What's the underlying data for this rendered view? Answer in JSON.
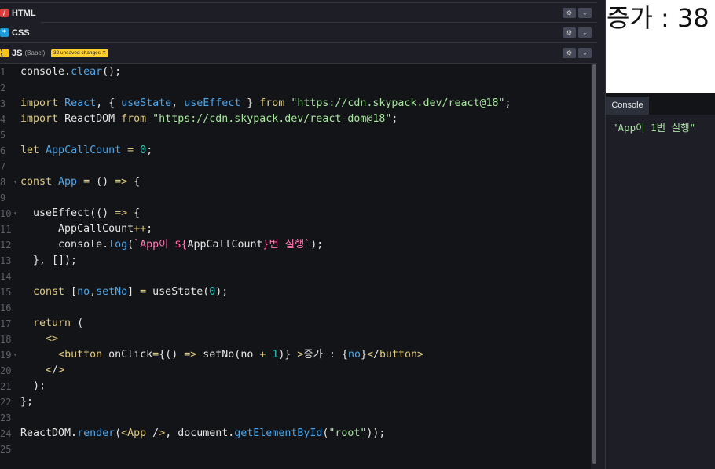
{
  "editors": {
    "html_tab": "HTML",
    "css_tab": "CSS",
    "js_tab": "JS",
    "js_sub": "(Babel)",
    "unsaved_badge": "32 unsaved changes ✕",
    "gear_icon": "gear-icon",
    "chevron_icon": "chevron-down-icon"
  },
  "code": {
    "line_numbers": [
      "1",
      "2",
      "3",
      "4",
      "5",
      "6",
      "7",
      "8",
      "9",
      "10",
      "11",
      "12",
      "13",
      "14",
      "15",
      "16",
      "17",
      "18",
      "19",
      "20",
      "21",
      "22",
      "23",
      "24",
      "25"
    ],
    "lines": [
      "console.clear();",
      "",
      "import React, { useState, useEffect } from \"https://cdn.skypack.dev/react@18\";",
      "import ReactDOM from \"https://cdn.skypack.dev/react-dom@18\";",
      "",
      "let AppCallCount = 0;",
      "",
      "const App = () => {",
      "",
      "  useEffect(() => {",
      "      AppCallCount++;",
      "      console.log(`App이 ${AppCallCount}번 실행`);",
      "  }, []);",
      "",
      "  const [no,setNo] = useState(0);",
      "",
      "  return (",
      "    <>",
      "      <button onClick={() => setNo(no + 1)} >증가 : {no}</button>",
      "    </>",
      "  );",
      "};",
      "",
      "ReactDOM.render(<App />, document.getElementById(\"root\"));",
      ""
    ]
  },
  "preview": {
    "button_text": "증가 : 38"
  },
  "console": {
    "tab_label": "Console",
    "log": "\"App이 1번 실행\""
  },
  "colors": {
    "keyword": "#ddca7e",
    "function": "#4ea6e8",
    "string": "#a8e5a0",
    "number": "#2bc7b9",
    "template": "#ff7ab3"
  }
}
